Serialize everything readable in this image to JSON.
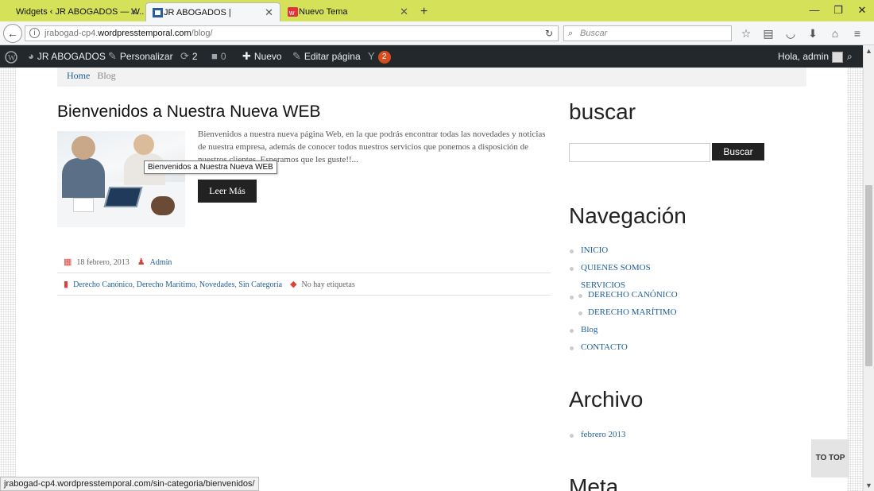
{
  "browser": {
    "tabs": [
      {
        "label": "Widgets ‹ JR ABOGADOS — W...",
        "active": false
      },
      {
        "label": "JR ABOGADOS |",
        "active": true
      },
      {
        "label": "Nuevo Tema",
        "active": false
      }
    ],
    "url": {
      "prefix": "jrabogad-cp4.",
      "host": "wordpresstemporal.com",
      "path": "/blog/"
    },
    "search_placeholder": "Buscar",
    "status_url": "jrabogad-cp4.wordpresstemporal.com/sin-categoria/bienvenidos/"
  },
  "adminbar": {
    "site_name": "JR ABOGADOS",
    "customize": "Personalizar",
    "updates_count": "2",
    "comments_count": "0",
    "new": "Nuevo",
    "edit_page": "Editar página",
    "yoast_badge": "2",
    "greeting": "Hola, admin"
  },
  "breadcrumb": {
    "home": "Home",
    "current": "Blog"
  },
  "post": {
    "title": "Bienvenidos a Nuestra Nueva WEB",
    "excerpt": "Bienvenidos a nuestra nueva página Web, en la que podrás encontrar todas las novedades y noticias de nuestra empresa, además de conocer todos nuestros servicios que ponemos a disposición de nuestros clientes. Esperamos que les guste!!...",
    "read_more": "Leer Más",
    "tooltip": "Bienvenidos a Nuestra Nueva WEB",
    "date": "18 febrero, 2013",
    "author": "Admin",
    "categories": [
      "Derecho Canónico",
      "Derecho Marítimo",
      "Novedades",
      "Sin Categoría"
    ],
    "tags": "No hay etiquetas"
  },
  "sidebar": {
    "search_title": "buscar",
    "search_button": "Buscar",
    "nav_title": "Navegación",
    "nav_items": [
      "INICIO",
      "QUIENES SOMOS",
      "SERVICIOS",
      "DERECHO CANÓNICO",
      "DERECHO MARÍTIMO",
      "Blog",
      "CONTACTO"
    ],
    "archive_title": "Archivo",
    "archive_items": [
      "febrero 2013"
    ],
    "meta_title": "Meta"
  },
  "to_top": "TO TOP"
}
